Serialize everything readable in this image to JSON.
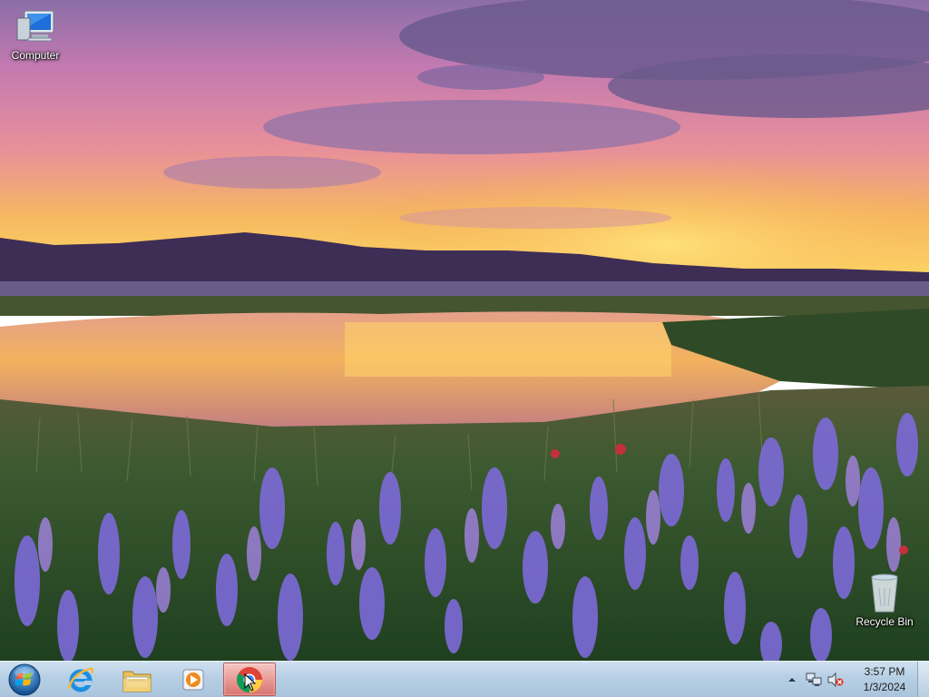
{
  "desktop": {
    "icons": [
      {
        "label": "Computer"
      },
      {
        "label": "Recycle Bin"
      }
    ]
  },
  "taskbar": {
    "start_icon": "windows-orb-icon",
    "pinned": [
      {
        "name": "Internet Explorer",
        "icon": "internet-explorer-icon"
      },
      {
        "name": "Windows Explorer",
        "icon": "folder-icon"
      },
      {
        "name": "Windows Media Player",
        "icon": "media-player-icon"
      },
      {
        "name": "Google Chrome",
        "icon": "chrome-icon",
        "active": true
      }
    ],
    "tray": {
      "icons": [
        "show-hidden-chevron-icon",
        "network-icon",
        "volume-muted-icon"
      ],
      "time": "3:57 PM",
      "date": "1/3/2024"
    }
  },
  "colors": {
    "taskbar": "#b7cfe4",
    "active_button": "#e89b96",
    "sky_top": "#8a6aa6",
    "horizon": "#f7c24a",
    "flowers": "#7d6ad8"
  }
}
